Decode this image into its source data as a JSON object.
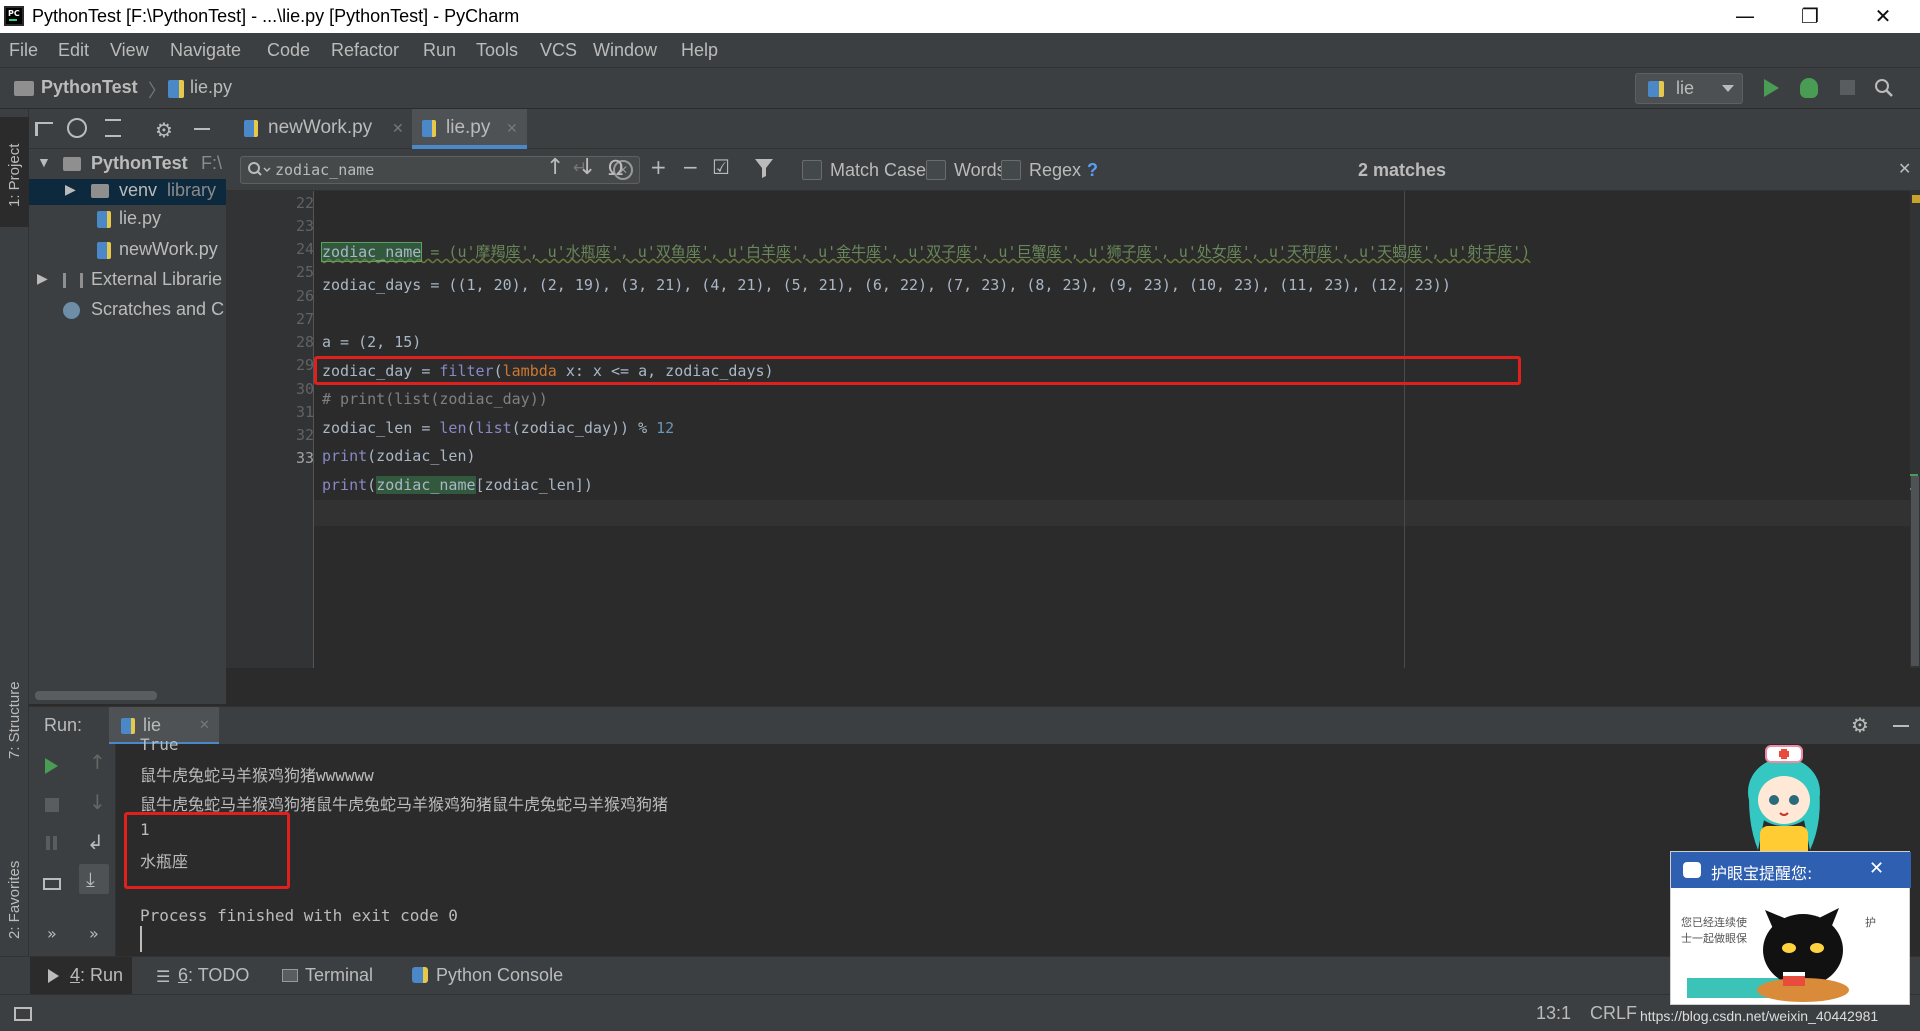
{
  "window": {
    "title": "PythonTest [F:\\PythonTest] - ...\\lie.py [PythonTest] - PyCharm",
    "app_icon": "PC"
  },
  "menu": [
    "File",
    "Edit",
    "View",
    "Navigate",
    "Code",
    "Refactor",
    "Run",
    "Tools",
    "VCS",
    "Window",
    "Help"
  ],
  "breadcrumb": {
    "project": "PythonTest",
    "file": "lie.py"
  },
  "run_config": {
    "name": "lie"
  },
  "sidebar_left": {
    "project_label": "1: Project",
    "structure_label": "7: Structure",
    "favorites_label": "2: Favorites"
  },
  "project_tree": {
    "root": "PythonTest",
    "root_path": "F:\\",
    "venv": "venv",
    "venv_hint": "library",
    "files": [
      "lie.py",
      "newWork.py"
    ],
    "external": "External Librarie",
    "scratches": "Scratches and C"
  },
  "tabs": [
    {
      "label": "newWork.py",
      "active": false
    },
    {
      "label": "lie.py",
      "active": true
    }
  ],
  "find": {
    "query": "zodiac_name",
    "match_case": "Match Case",
    "words": "Words",
    "regex": "Regex",
    "help": "?",
    "result": "2 matches"
  },
  "editor": {
    "line_numbers": [
      "22",
      "23",
      "24",
      "25",
      "26",
      "27",
      "28",
      "29",
      "30",
      "31",
      "32",
      "33"
    ],
    "lines": [
      "",
      "",
      "zodiac_name = (u'摩羯座', u'水瓶座', u'双鱼座', u'白羊座', u'金牛座', u'双子座', u'巨蟹座', u'狮子座', u'处女座', u'天秤座', u'天蝎座', u'射手座')",
      "zodiac_days = ((1, 20), (2, 19), (3, 21), (4, 21), (5, 21), (6, 22), (7, 23), (8, 23), (9, 23), (10, 23), (11, 23), (12, 23))",
      "",
      "a = (2, 15)",
      "zodiac_day = filter(lambda x: x <= a, zodiac_days)",
      "# print(list(zodiac_day))",
      "zodiac_len = len(list(zodiac_day)) % 12",
      "print(zodiac_len)",
      "print(zodiac_name[zodiac_len])",
      ""
    ],
    "code_24": {
      "var": "zodiac_name",
      "rest": " = (u'摩羯座', u'水瓶座', u'双鱼座', u'白羊座', u'金牛座', u'双子座', u'巨蟹座', u'狮子座', u'处女座', u'天秤座', u'天蝎座', u'射手座')"
    },
    "code_25": "zodiac_days = ((1, 20), (2, 19), (3, 21), (4, 21), (5, 21), (6, 22), (7, 23), (8, 23), (9, 23), (10, 23), (11, 23), (12, 23))",
    "code_27": "a = (2, 15)",
    "code_28": {
      "a": "zodiac_day = ",
      "b": "filter",
      "c": "(",
      "d": "lambda",
      "e": " x: x <= a, zodiac_days)"
    },
    "code_29": "# print(list(zodiac_day))",
    "code_30": {
      "a": "zodiac_len = ",
      "b": "len",
      "c": "(",
      "d": "list",
      "e": "(zodiac_day)) % ",
      "f": "12"
    },
    "code_31": {
      "a": "print",
      "b": "(zodiac_len)"
    },
    "code_32": {
      "a": "print",
      "b": "(",
      "c": "zodiac_name",
      "d": "[zodiac_len])"
    }
  },
  "run": {
    "label": "Run:",
    "tab": "lie",
    "output": [
      "True",
      "鼠牛虎兔蛇马羊猴鸡狗猪wwwwww",
      "鼠牛虎兔蛇马羊猴鸡狗猪鼠牛虎兔蛇马羊猴鸡狗猪鼠牛虎兔蛇马羊猴鸡狗猪",
      "1",
      "水瓶座",
      "",
      "Process finished with exit code 0"
    ]
  },
  "bottom_tabs": [
    {
      "num": "4",
      "label": ": Run"
    },
    {
      "num": "6",
      "label": ": TODO"
    },
    {
      "num": "",
      "label": "Terminal"
    },
    {
      "num": "",
      "label": "Python Console"
    }
  ],
  "status": {
    "position": "13:1",
    "line_sep": "CRLF",
    "watermark": "https://blog.csdn.net/weixin_40442981"
  },
  "popup": {
    "title": "护眼宝提醒您:",
    "text1": "您已经连续使",
    "text2": "士一起做眼保",
    "right1": "护"
  },
  "colors": {
    "bg": "#2b2b2b",
    "panel": "#3c3f41",
    "keyword": "#cc7832",
    "string": "#6a8759",
    "number": "#6897bb",
    "builtin": "#8888c6",
    "comment": "#808080",
    "highlight_red": "#e0201c",
    "match_bg": "#32593d"
  }
}
